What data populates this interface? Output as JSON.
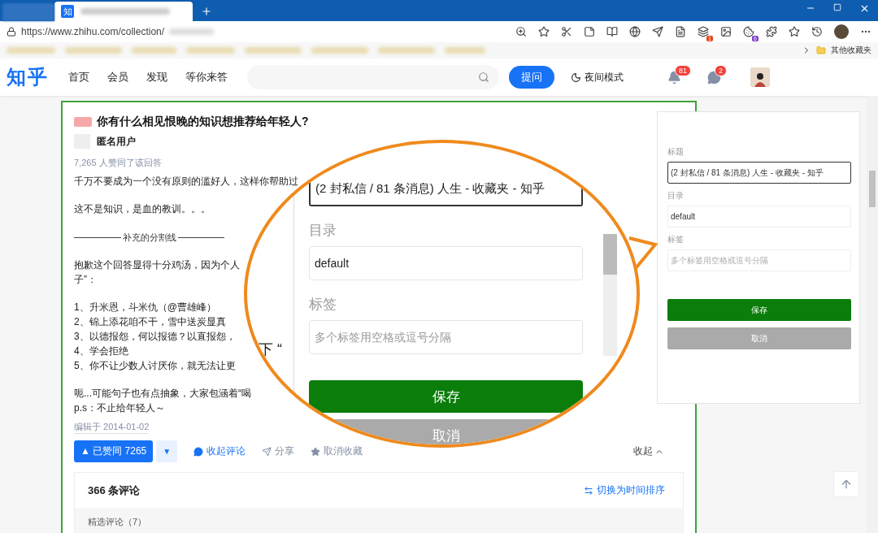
{
  "browser": {
    "active_tab_favicon": "知",
    "url": "https://www.zhihu.com/collection/",
    "extension_badges": [
      "1",
      "6"
    ],
    "other_bookmarks": "其他收藏夹"
  },
  "header": {
    "logo": "知乎",
    "nav": [
      {
        "label": "首页"
      },
      {
        "label": "会员"
      },
      {
        "label": "发现"
      },
      {
        "label": "等你来答"
      }
    ],
    "ask_button": "提问",
    "night_mode": "夜间模式",
    "notification_count": "81",
    "message_count": "2"
  },
  "answer": {
    "question": "你有什么相见恨晚的知识想推荐给年轻人?",
    "author": "匿名用户",
    "votes_note": "7,265 人赞同了该回答",
    "blocks": [
      {
        "kind": "para",
        "lines": [
          "千万不要成为一个没有原则的滥好人，这样你帮助过"
        ]
      },
      {
        "kind": "para",
        "lines": [
          "这不是知识，是血的教训。。。"
        ]
      },
      {
        "kind": "divider",
        "lines": [
          "补充的分割线"
        ]
      },
      {
        "kind": "para",
        "lines": [
          "抱歉这个回答显得十分鸡汤，因为个人",
          "子”："
        ]
      },
      {
        "kind": "para",
        "lines": [
          "1、升米恩，斗米仇（@曹雄峰）",
          "2、锦上添花咱不干，雪中送炭显真",
          "3、以德报怨，何以报德？以直报怨，",
          "4、学会拒绝",
          "5、你不让少数人讨厌你，就无法让更"
        ]
      },
      {
        "kind": "para",
        "lines": [
          "呃...可能句子也有点抽象，大家包涵着“喝",
          "p.s：不止给年轻人～"
        ]
      }
    ],
    "edited": "编辑于 2014-01-02",
    "upvote": {
      "label": "▲ 已赞同 7265",
      "selected": true
    },
    "downvote": "▼",
    "actions": [
      "收起评论",
      "分享",
      "取消收藏"
    ],
    "collapse": "收起"
  },
  "comments": {
    "count": "366 条评论",
    "sort_toggle": "切换为时间排序",
    "featured": "精选评论（7）"
  },
  "save_panel": {
    "fields": [
      {
        "label": "标题",
        "value": "(2 封私信 / 81 条消息) 人生 - 收藏夹 - 知乎",
        "focused": true
      },
      {
        "label": "目录",
        "value": "default",
        "focused": false
      },
      {
        "label": "标签",
        "placeholder": "多个标签用空格或逗号分隔",
        "focused": false
      }
    ],
    "buttons": [
      {
        "label": "保存",
        "kind": "primary"
      },
      {
        "label": "取消",
        "kind": "secondary"
      }
    ]
  },
  "magnifier": {
    "fragment": "下 “",
    "title_value": "(2 封私信 / 81 条消息) 人生 - 收藏夹 - 知乎",
    "fields": [
      {
        "label": "目录",
        "value": "default"
      },
      {
        "label": "标签",
        "placeholder": "多个标签用空格或逗号分隔"
      }
    ],
    "save": "保存",
    "cancel": "取消"
  }
}
